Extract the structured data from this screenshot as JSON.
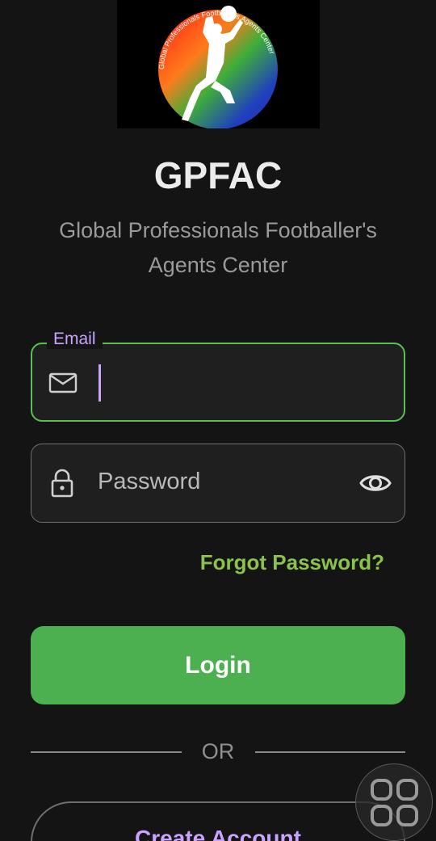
{
  "logo": {
    "ring_text": "Global Professionals Footballer's Agents Center"
  },
  "app": {
    "title": "GPFAC",
    "subtitle_line1": "Global Professionals Footballer's",
    "subtitle_line2": "Agents Center"
  },
  "email_field": {
    "label": "Email",
    "value": "",
    "icon": "mail-icon"
  },
  "password_field": {
    "placeholder": "Password",
    "icon": "lock-icon",
    "toggle_icon": "eye-icon"
  },
  "links": {
    "forgot_password": "Forgot Password?"
  },
  "buttons": {
    "login": "Login",
    "create_account": "Create Account"
  },
  "divider": {
    "text": "OR"
  },
  "floating_button": {
    "icon": "grid-icon"
  },
  "colors": {
    "background": "#141414",
    "accent_green": "#4caf50",
    "link_green": "#8bc34a",
    "accent_purple": "#c8a4ff"
  }
}
